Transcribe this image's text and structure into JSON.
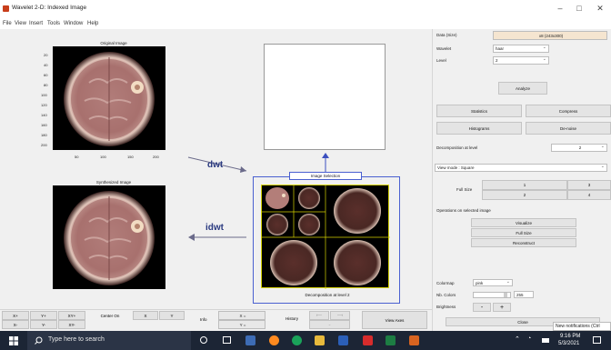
{
  "window": {
    "title": "Wavelet 2-D: Indexed Image",
    "min": "–",
    "max": "□",
    "close": "✕"
  },
  "menu": [
    "File",
    "View",
    "Insert",
    "Tools",
    "Window",
    "Help"
  ],
  "left_panel": {
    "original_title": "Original Image",
    "synth_title": "Synthesized Image",
    "yticks": [
      "20",
      "40",
      "60",
      "80",
      "100",
      "120",
      "140",
      "160",
      "180",
      "200"
    ],
    "xticks": [
      "50",
      "100",
      "150",
      "200"
    ],
    "dwt_label": "dwt",
    "idwt_label": "idwt",
    "image_selection": "Image Selection",
    "decomposition_caption": "Decomposition at level 2"
  },
  "right_panel": {
    "data_label": "Data (Size)",
    "data_value": "x8 (243x300)",
    "wavelet_label": "Wavelet",
    "wavelet_value": "haar",
    "level_label": "Level",
    "level_value": "2",
    "analyze": "Analyze",
    "statistics": "Statistics",
    "compress": "Compress",
    "histograms": "Histograms",
    "denoise": "De-noise",
    "decomp_at_level": "Decomposition at level",
    "decomp_level_value": "2",
    "view_mode": "View mode : Square",
    "full_size": "Full Size",
    "fs_buttons": [
      "1",
      "3",
      "2",
      "4"
    ],
    "ops_label": "Operations on selected image",
    "visualize": "Visualize",
    "full_size_btn": "Full Size",
    "reconstruct": "Reconstruct",
    "colormap_label": "Colormap",
    "colormap_value": "pink",
    "nb_colors_label": "Nb. Colors",
    "nb_colors_value": "255",
    "brightness_label": "Brightness",
    "minus": "-",
    "plus": "+",
    "close": "Close"
  },
  "bottom_bar": {
    "xy": [
      "X+",
      "Y+",
      "XY+",
      "X-",
      "Y-",
      "XY-"
    ],
    "center_on": "Center On",
    "x": "X",
    "y": "Y",
    "info": "Info",
    "x_coord": "X =",
    "y_coord": "Y =",
    "history": "History",
    "view_axes": "View Axes"
  },
  "taskbar": {
    "search_placeholder": "Type here to search",
    "time": "9:16 PM",
    "date": "5/3/2021",
    "notification": "New notifications (Ctrl"
  }
}
